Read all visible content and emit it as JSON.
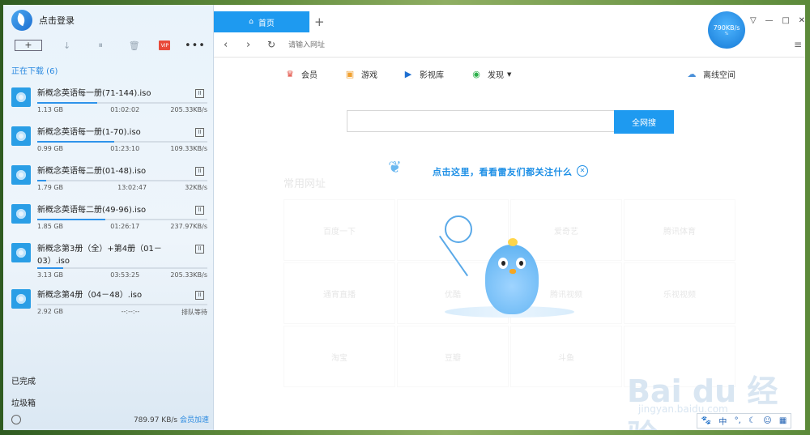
{
  "app": {
    "login_text": "点击登录"
  },
  "toolbar": {
    "new_label": "+",
    "vip_label": "VIP",
    "more_label": "•••"
  },
  "downloads": {
    "header": "正在下载 (6)",
    "items": [
      {
        "name": "新概念英语每一册(71-144).iso",
        "size": "1.13 GB",
        "time": "01:02:02",
        "speed": "205.33KB/s",
        "progress": 0.35
      },
      {
        "name": "新概念英语每一册(1-70).iso",
        "size": "0.99 GB",
        "time": "01:23:10",
        "speed": "109.33KB/s",
        "progress": 0.45
      },
      {
        "name": "新概念英语每二册(01-48).iso",
        "size": "1.79 GB",
        "time": "13:02:47",
        "speed": "32KB/s",
        "progress": 0.05
      },
      {
        "name": "新概念英语每二册(49-96).iso",
        "size": "1.85 GB",
        "time": "01:26:17",
        "speed": "237.97KB/s",
        "progress": 0.4
      },
      {
        "name": "新概念第3册（全）+第4册（01－03）.iso",
        "size": "3.13 GB",
        "time": "03:53:25",
        "speed": "205.33KB/s",
        "progress": 0.15
      },
      {
        "name": "新概念第4册（04－48）.iso",
        "size": "2.92 GB",
        "time": "--:--:--",
        "speed": "排队等待",
        "progress": 0.0
      }
    ]
  },
  "sidebar_bottom": {
    "completed": "已完成",
    "trash": "垃圾箱",
    "total_speed": "789.97 KB/s",
    "vip_boost": "会员加速"
  },
  "browser": {
    "tab_label": "首页",
    "tab_add": "+",
    "speed_badge": "790KB/s",
    "url_placeholder": "请输入网址",
    "nav_links": [
      "会员",
      "游戏",
      "影视库",
      "发现",
      "离线空间"
    ],
    "search_button": "全网搜",
    "promo_text": "点击这里，看看雷友们都关注什么",
    "common_title": "常用网址",
    "sites": [
      "百度一下",
      "",
      "爱奇艺",
      "腾讯体育",
      "通宵直播",
      "优酷",
      "腾讯视频",
      "乐视视频",
      "淘宝",
      "豆瓣",
      "斗鱼",
      ""
    ]
  },
  "watermark": {
    "main": "Bai du 经验",
    "sub": "jingyan.baidu.com"
  },
  "ime": {
    "label": "中"
  },
  "colors": {
    "accent": "#1e9af0",
    "link": "#2b8ae0"
  }
}
